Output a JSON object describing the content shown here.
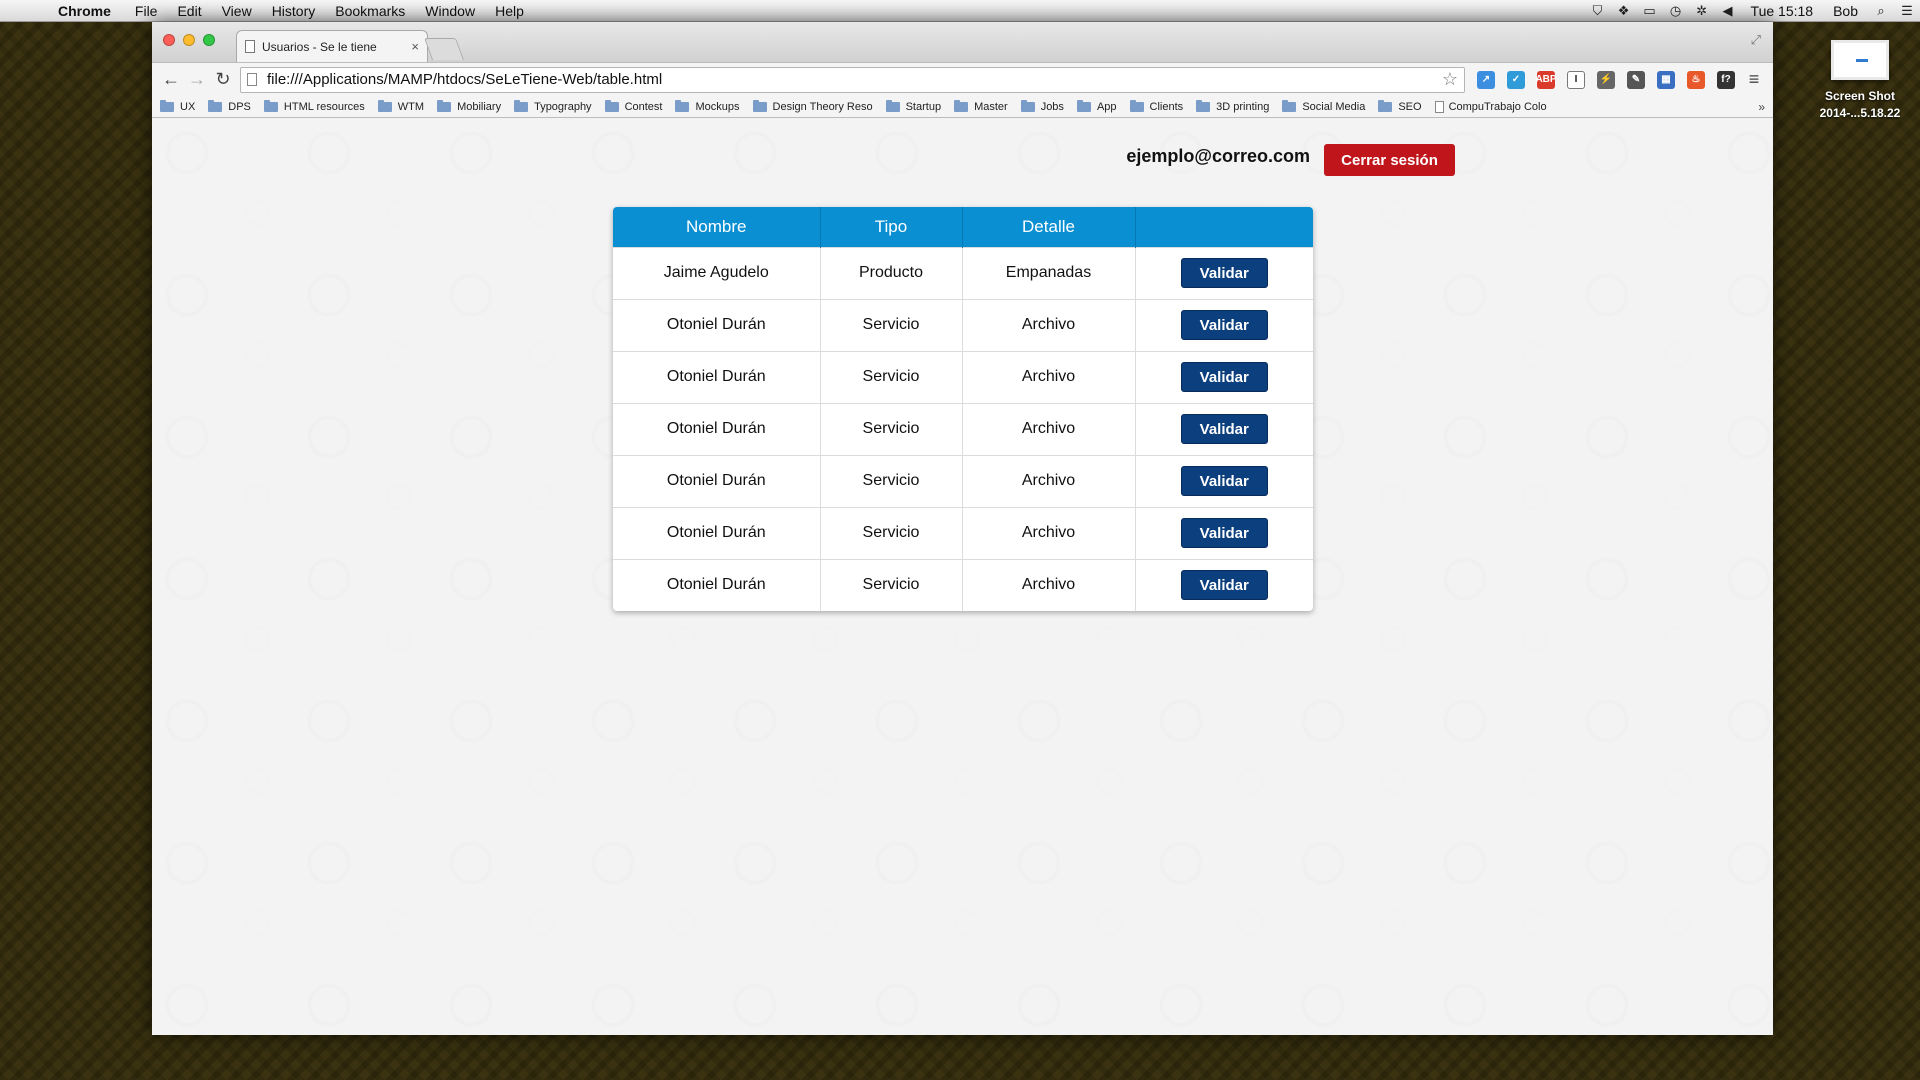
{
  "menubar": {
    "app_name": "Chrome",
    "items": [
      "File",
      "Edit",
      "View",
      "History",
      "Bookmarks",
      "Window",
      "Help"
    ],
    "clock": "Tue 15:18",
    "user": "Bob"
  },
  "desktop": {
    "icon_label_1": "Screen Shot",
    "icon_label_2": "2014-...5.18.22"
  },
  "browser": {
    "tab_title": "Usuarios - Se le tiene",
    "tab_close": "×",
    "url": "file:///Applications/MAMP/htdocs/SeLeTiene-Web/table.html",
    "bookmarks": [
      "UX",
      "DPS",
      "HTML resources",
      "WTM",
      "Mobiliary",
      "Typography",
      "Contest",
      "Mockups",
      "Design Theory Reso",
      "Startup",
      "Master",
      "Jobs",
      "App",
      "Clients",
      "3D printing",
      "Social Media",
      "SEO"
    ],
    "bookmark_doc": "CompuTrabajo Colo",
    "bookmarks_more": "»",
    "extensions": [
      {
        "name": "bookmark-ext-icon",
        "color": "#3c8ee0",
        "glyph": "↗"
      },
      {
        "name": "check-ext-icon",
        "color": "#2f9bd8",
        "glyph": "✓"
      },
      {
        "name": "adblock-icon",
        "color": "#d93a2b",
        "glyph": "ABP"
      },
      {
        "name": "instapaper-icon",
        "color": "#ffffff",
        "glyph": "I"
      },
      {
        "name": "bolt-ext-icon",
        "color": "#666666",
        "glyph": "⚡"
      },
      {
        "name": "evernote-icon",
        "color": "#555555",
        "glyph": "✎"
      },
      {
        "name": "grid-ext-icon",
        "color": "#3a6fc2",
        "glyph": "▦"
      },
      {
        "name": "fire-ext-icon",
        "color": "#e8582a",
        "glyph": "♨"
      },
      {
        "name": "font-ext-icon",
        "color": "#333333",
        "glyph": "f?"
      }
    ]
  },
  "page": {
    "user_email": "ejemplo@correo.com",
    "logout_label": "Cerrar sesión",
    "table": {
      "headers": [
        "Nombre",
        "Tipo",
        "Detalle",
        ""
      ],
      "action_label": "Validar",
      "rows": [
        {
          "nombre": "Jaime Agudelo",
          "tipo": "Producto",
          "detalle": "Empanadas"
        },
        {
          "nombre": "Otoniel Durán",
          "tipo": "Servicio",
          "detalle": "Archivo"
        },
        {
          "nombre": "Otoniel Durán",
          "tipo": "Servicio",
          "detalle": "Archivo"
        },
        {
          "nombre": "Otoniel Durán",
          "tipo": "Servicio",
          "detalle": "Archivo"
        },
        {
          "nombre": "Otoniel Durán",
          "tipo": "Servicio",
          "detalle": "Archivo"
        },
        {
          "nombre": "Otoniel Durán",
          "tipo": "Servicio",
          "detalle": "Archivo"
        },
        {
          "nombre": "Otoniel Durán",
          "tipo": "Servicio",
          "detalle": "Archivo"
        }
      ]
    }
  },
  "colors": {
    "header_blue": "#0a8fd2",
    "button_navy": "#0b3f7d",
    "logout_red": "#c0161b"
  }
}
